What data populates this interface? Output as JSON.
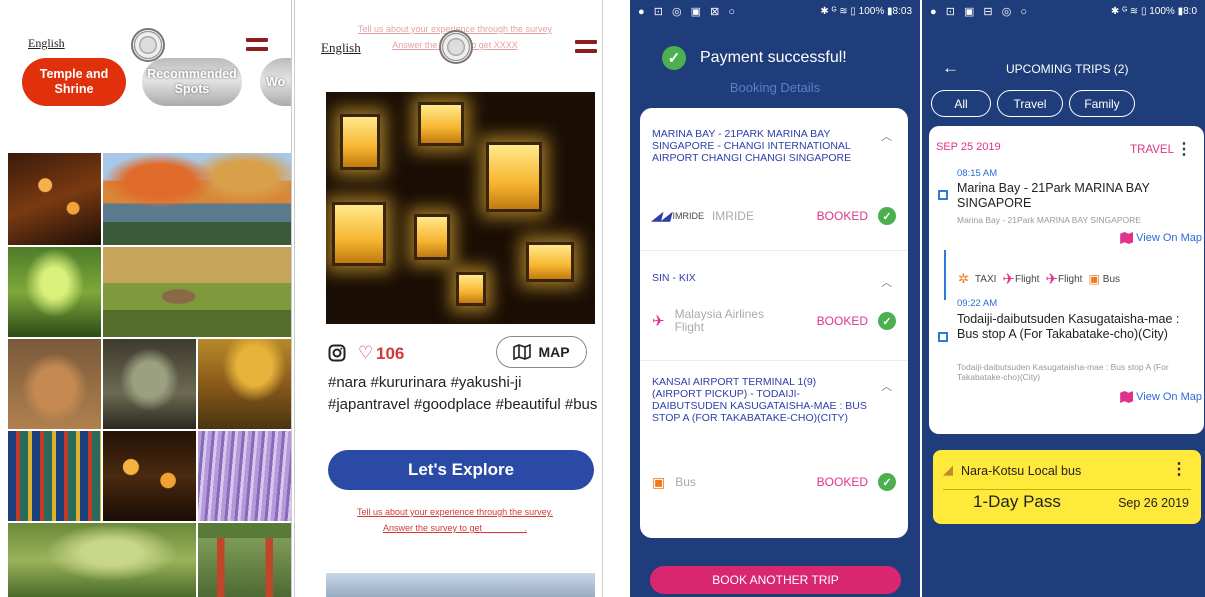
{
  "screen1": {
    "language": "English",
    "categories": [
      {
        "label": "Temple and Shrine",
        "bg": "#e0300c"
      },
      {
        "label": "Recommended Spots",
        "bg": "#c9c9c9"
      },
      {
        "label": "Wo",
        "bg": "#c9c9c9"
      }
    ],
    "icons": {
      "logo": "temple-seal-icon",
      "menu": "hamburger-menu-icon"
    }
  },
  "screen2": {
    "language": "English",
    "ghost_survey": [
      "Tell us about your experience through the survey",
      "Answer the survey to get XXXX"
    ],
    "like_count": "106",
    "map_label": "MAP",
    "hashtags": "#nara #kururinara #yakushi-ji #japantravel #goodplace #beautiful #bus",
    "explore_label": "Let's Explore",
    "survey_line1": "Tell us about your experience through the survey.",
    "survey_line2": "Answer the survey to get ________."
  },
  "screen3": {
    "status": {
      "left": "● ⊡ ◎ ▣ ⊠ ○",
      "right": "✱ ᴳ ≋ ▯ 100% ▮8:03"
    },
    "payment_title": "Payment successful!",
    "booking_details": "Booking Details",
    "bookings": [
      {
        "route": "MARINA BAY - 21PARK MARINA BAY SINGAPORE - CHANGI INTERNATIONAL AIRPORT CHANGI CHANGI SINGAPORE",
        "provider": "IMRIDE",
        "logo": "IMRIDE",
        "status": "BOOKED"
      },
      {
        "route": "SIN - KIX",
        "provider": "Malaysia Airlines Flight",
        "status": "BOOKED"
      },
      {
        "route": "KANSAI AIRPORT TERMINAL 1(9) (AIRPORT PICKUP) - TODAIJI-DAIBUTSUDEN KASUGATAISHA-MAE : BUS STOP A (FOR TAKABATAKE-CHO)(CITY)",
        "provider": "Bus",
        "status": "BOOKED"
      }
    ],
    "book_another": "BOOK ANOTHER TRIP",
    "colors": {
      "accent": "#e0338c",
      "navy": "#1e3d7a",
      "ok": "#4caf50"
    }
  },
  "screen4": {
    "status": {
      "left": "● ⊡ ▣ ⊟ ◎ ○",
      "right": "✱ ᴳ ≋ ▯ 100% ▮8:0"
    },
    "title": "UPCOMING TRIPS (2)",
    "filters": [
      "All",
      "Travel",
      "Family"
    ],
    "trip": {
      "date": "SEP 25 2019",
      "tag": "TRAVEL",
      "stop1": {
        "time": "08:15 AM",
        "title": "Marina Bay - 21Park MARINA BAY SINGAPORE",
        "sub": "Marina Bay - 21Park MARINA BAY SINGAPORE",
        "map": "View On Map"
      },
      "modes": [
        "TAXI",
        "Flight",
        "Flight",
        "Bus"
      ],
      "stop2": {
        "time": "09:22 AM",
        "title": "Todaiji-daibutsuden Kasugataisha-mae : Bus stop A (For Takabatake-cho)(City)",
        "sub": "Todaiji-daibutsuden Kasugataisha-mae : Bus stop A (For Takabatake-cho)(City)",
        "map": "View On Map"
      }
    },
    "pass": {
      "operator": "Nara-Kotsu Local bus",
      "name": "1-Day Pass",
      "date": "Sep 26 2019"
    }
  }
}
